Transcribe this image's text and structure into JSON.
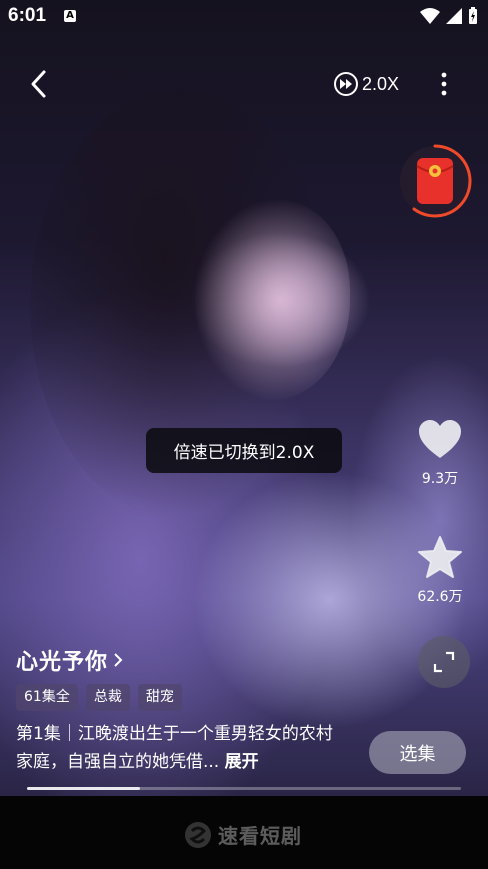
{
  "status_bar": {
    "time": "6:01",
    "notification_badge": "A"
  },
  "player": {
    "speed_label": "2.0X",
    "toast": "倍速已切换到2.0X",
    "progress": 0.26
  },
  "actions": {
    "likes": "9.3万",
    "favorites": "62.6万"
  },
  "drama": {
    "title": "心光予你",
    "tags": [
      "61集全",
      "总裁",
      "甜宠"
    ],
    "description": "第1集｜江晚渡出生于一个重男轻女的农村家庭，自强自立的她凭借...",
    "expand_label": "展开",
    "episodes_button": "选集"
  },
  "watermark": "速看短剧",
  "colors": {
    "redpacket": "#e8312a",
    "ring": "#f04a2a"
  }
}
